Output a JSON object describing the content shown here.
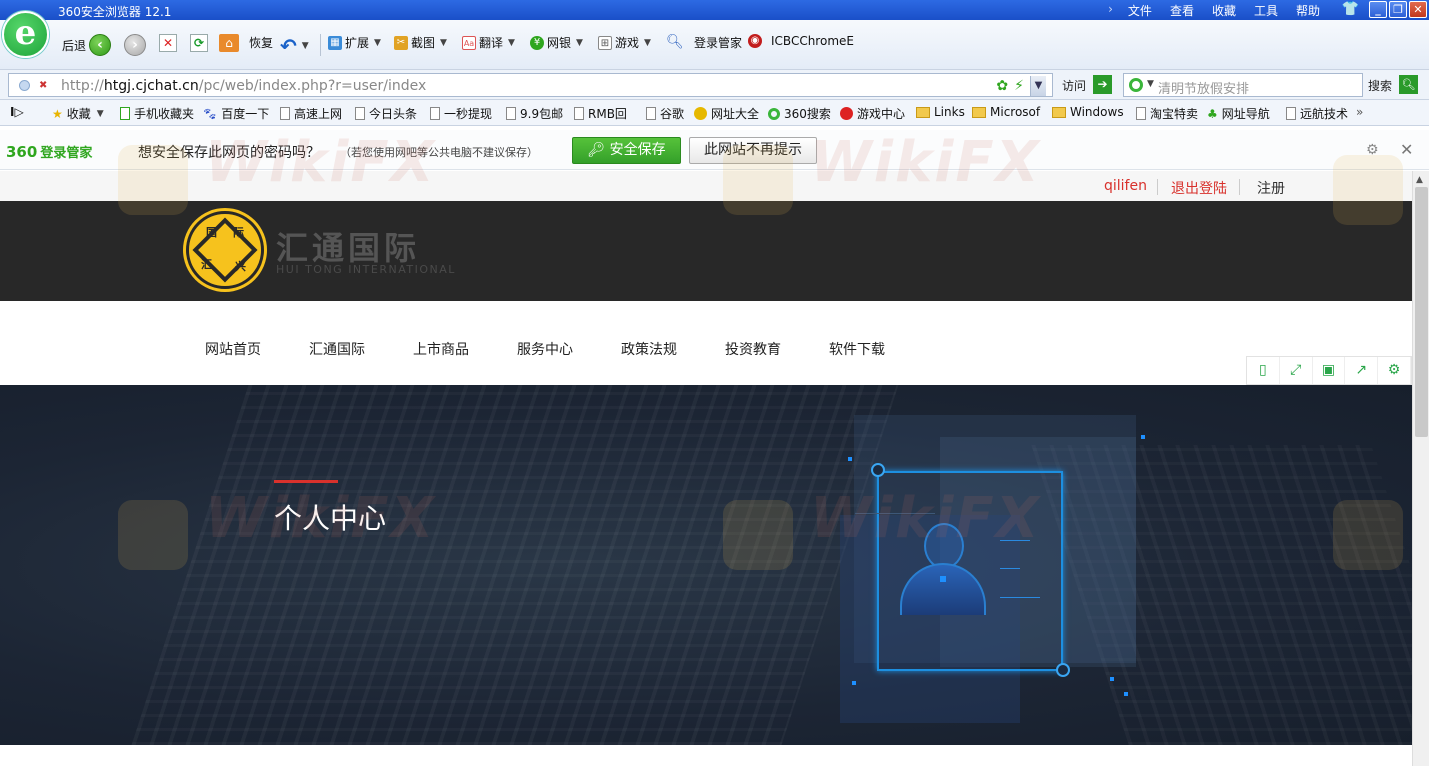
{
  "browser": {
    "title": "360安全浏览器 12.1",
    "menus": [
      "文件",
      "查看",
      "收藏",
      "工具",
      "帮助"
    ],
    "chevron": "›",
    "win_buttons": [
      "_",
      "❐",
      "✕"
    ]
  },
  "toolbar": {
    "back_label": "后退",
    "restore_label": "恢复",
    "extensions_label": "扩展",
    "screenshot_label": "截图",
    "translate_label": "翻译",
    "bank_label": "网银",
    "game_label": "游戏",
    "login_manager_label": "登录管家",
    "icbc_label": "ICBCChromeE"
  },
  "address": {
    "url_prefix": "http://",
    "url_host": "htgj.cjchat.cn",
    "url_path": "/pc/web/index.php?r=user/index",
    "goto_label": "访问",
    "search_placeholder": "清明节放假安排",
    "search_label": "搜索"
  },
  "favorites": [
    "收藏",
    "手机收藏夹",
    "百度一下",
    "高速上网",
    "今日头条",
    "一秒提现",
    "9.9包邮",
    "RMB回",
    "谷歌",
    "网址大全",
    "360搜索",
    "游戏中心",
    "Links",
    "Microsof",
    "Windows",
    "淘宝特卖",
    "网址导航",
    "远航技术"
  ],
  "password_bar": {
    "brand_number": "360",
    "brand_text": "登录管家",
    "question": "想安全保存此网页的密码吗？",
    "hint": "（若您使用网吧等公共电脑不建议保存）",
    "save_button": "安全保存",
    "never_button": "此网站不再提示"
  },
  "page": {
    "user": {
      "username": "qilifen",
      "logout": "退出登陆",
      "register": "注册"
    },
    "site": {
      "name_cn": "汇通国际",
      "name_en": "HUI TONG INTERNATIONAL",
      "logo_chars": [
        "国",
        "际",
        "汇",
        "兴"
      ]
    },
    "nav": [
      "网站首页",
      "汇通国际",
      "上市商品",
      "服务中心",
      "政策法规",
      "投资教育",
      "软件下载"
    ],
    "banner_title": "个人中心"
  },
  "watermark": "WikiFX",
  "colors": {
    "accent_red": "#d8312c",
    "brand_green": "#2fa61f",
    "logo_gold": "#f6c21d",
    "header_dark": "#282828"
  }
}
